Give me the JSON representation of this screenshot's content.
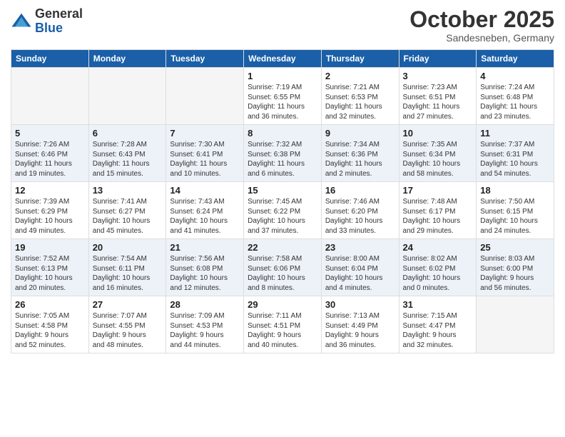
{
  "logo": {
    "general": "General",
    "blue": "Blue"
  },
  "title": "October 2025",
  "subtitle": "Sandesneben, Germany",
  "headers": [
    "Sunday",
    "Monday",
    "Tuesday",
    "Wednesday",
    "Thursday",
    "Friday",
    "Saturday"
  ],
  "weeks": [
    [
      {
        "day": "",
        "info": ""
      },
      {
        "day": "",
        "info": ""
      },
      {
        "day": "",
        "info": ""
      },
      {
        "day": "1",
        "info": "Sunrise: 7:19 AM\nSunset: 6:55 PM\nDaylight: 11 hours\nand 36 minutes."
      },
      {
        "day": "2",
        "info": "Sunrise: 7:21 AM\nSunset: 6:53 PM\nDaylight: 11 hours\nand 32 minutes."
      },
      {
        "day": "3",
        "info": "Sunrise: 7:23 AM\nSunset: 6:51 PM\nDaylight: 11 hours\nand 27 minutes."
      },
      {
        "day": "4",
        "info": "Sunrise: 7:24 AM\nSunset: 6:48 PM\nDaylight: 11 hours\nand 23 minutes."
      }
    ],
    [
      {
        "day": "5",
        "info": "Sunrise: 7:26 AM\nSunset: 6:46 PM\nDaylight: 11 hours\nand 19 minutes."
      },
      {
        "day": "6",
        "info": "Sunrise: 7:28 AM\nSunset: 6:43 PM\nDaylight: 11 hours\nand 15 minutes."
      },
      {
        "day": "7",
        "info": "Sunrise: 7:30 AM\nSunset: 6:41 PM\nDaylight: 11 hours\nand 10 minutes."
      },
      {
        "day": "8",
        "info": "Sunrise: 7:32 AM\nSunset: 6:38 PM\nDaylight: 11 hours\nand 6 minutes."
      },
      {
        "day": "9",
        "info": "Sunrise: 7:34 AM\nSunset: 6:36 PM\nDaylight: 11 hours\nand 2 minutes."
      },
      {
        "day": "10",
        "info": "Sunrise: 7:35 AM\nSunset: 6:34 PM\nDaylight: 10 hours\nand 58 minutes."
      },
      {
        "day": "11",
        "info": "Sunrise: 7:37 AM\nSunset: 6:31 PM\nDaylight: 10 hours\nand 54 minutes."
      }
    ],
    [
      {
        "day": "12",
        "info": "Sunrise: 7:39 AM\nSunset: 6:29 PM\nDaylight: 10 hours\nand 49 minutes."
      },
      {
        "day": "13",
        "info": "Sunrise: 7:41 AM\nSunset: 6:27 PM\nDaylight: 10 hours\nand 45 minutes."
      },
      {
        "day": "14",
        "info": "Sunrise: 7:43 AM\nSunset: 6:24 PM\nDaylight: 10 hours\nand 41 minutes."
      },
      {
        "day": "15",
        "info": "Sunrise: 7:45 AM\nSunset: 6:22 PM\nDaylight: 10 hours\nand 37 minutes."
      },
      {
        "day": "16",
        "info": "Sunrise: 7:46 AM\nSunset: 6:20 PM\nDaylight: 10 hours\nand 33 minutes."
      },
      {
        "day": "17",
        "info": "Sunrise: 7:48 AM\nSunset: 6:17 PM\nDaylight: 10 hours\nand 29 minutes."
      },
      {
        "day": "18",
        "info": "Sunrise: 7:50 AM\nSunset: 6:15 PM\nDaylight: 10 hours\nand 24 minutes."
      }
    ],
    [
      {
        "day": "19",
        "info": "Sunrise: 7:52 AM\nSunset: 6:13 PM\nDaylight: 10 hours\nand 20 minutes."
      },
      {
        "day": "20",
        "info": "Sunrise: 7:54 AM\nSunset: 6:11 PM\nDaylight: 10 hours\nand 16 minutes."
      },
      {
        "day": "21",
        "info": "Sunrise: 7:56 AM\nSunset: 6:08 PM\nDaylight: 10 hours\nand 12 minutes."
      },
      {
        "day": "22",
        "info": "Sunrise: 7:58 AM\nSunset: 6:06 PM\nDaylight: 10 hours\nand 8 minutes."
      },
      {
        "day": "23",
        "info": "Sunrise: 8:00 AM\nSunset: 6:04 PM\nDaylight: 10 hours\nand 4 minutes."
      },
      {
        "day": "24",
        "info": "Sunrise: 8:02 AM\nSunset: 6:02 PM\nDaylight: 10 hours\nand 0 minutes."
      },
      {
        "day": "25",
        "info": "Sunrise: 8:03 AM\nSunset: 6:00 PM\nDaylight: 9 hours\nand 56 minutes."
      }
    ],
    [
      {
        "day": "26",
        "info": "Sunrise: 7:05 AM\nSunset: 4:58 PM\nDaylight: 9 hours\nand 52 minutes."
      },
      {
        "day": "27",
        "info": "Sunrise: 7:07 AM\nSunset: 4:55 PM\nDaylight: 9 hours\nand 48 minutes."
      },
      {
        "day": "28",
        "info": "Sunrise: 7:09 AM\nSunset: 4:53 PM\nDaylight: 9 hours\nand 44 minutes."
      },
      {
        "day": "29",
        "info": "Sunrise: 7:11 AM\nSunset: 4:51 PM\nDaylight: 9 hours\nand 40 minutes."
      },
      {
        "day": "30",
        "info": "Sunrise: 7:13 AM\nSunset: 4:49 PM\nDaylight: 9 hours\nand 36 minutes."
      },
      {
        "day": "31",
        "info": "Sunrise: 7:15 AM\nSunset: 4:47 PM\nDaylight: 9 hours\nand 32 minutes."
      },
      {
        "day": "",
        "info": ""
      }
    ]
  ]
}
